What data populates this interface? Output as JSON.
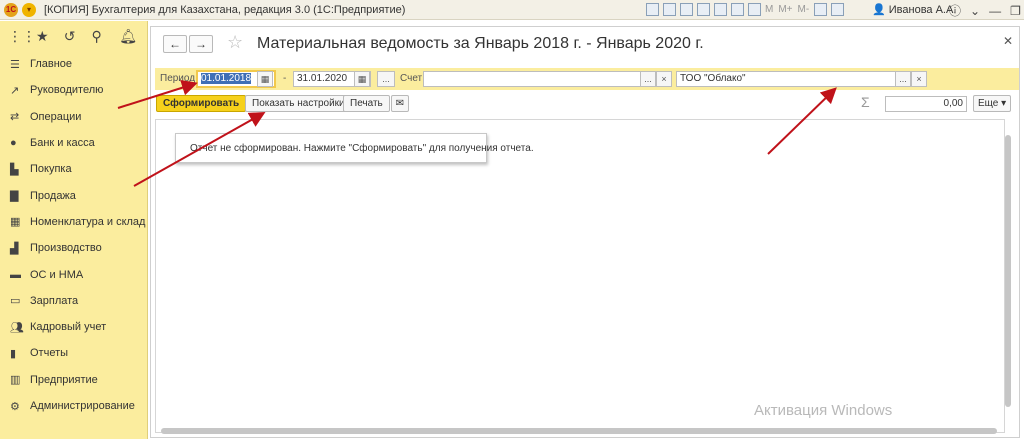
{
  "window": {
    "title": "[КОПИЯ] Бухгалтерия для Казахстана, редакция 3.0  (1С:Предприятие)",
    "tool_letters": [
      "M",
      "M+",
      "M-"
    ],
    "user": "Иванова А.А."
  },
  "sidebar": {
    "items": [
      {
        "label": "Главное",
        "icon": "menu-icon"
      },
      {
        "label": "Руководителю",
        "icon": "chart-line-icon"
      },
      {
        "label": "Операции",
        "icon": "operations-icon"
      },
      {
        "label": "Банк и касса",
        "icon": "bank-icon"
      },
      {
        "label": "Покупка",
        "icon": "cart-icon"
      },
      {
        "label": "Продажа",
        "icon": "bag-icon"
      },
      {
        "label": "Номенклатура и склад",
        "icon": "boxes-icon"
      },
      {
        "label": "Производство",
        "icon": "factory-icon"
      },
      {
        "label": "ОС и НМА",
        "icon": "truck-icon"
      },
      {
        "label": "Зарплата",
        "icon": "wallet-icon"
      },
      {
        "label": "Кадровый учет",
        "icon": "people-icon"
      },
      {
        "label": "Отчеты",
        "icon": "bar-chart-icon"
      },
      {
        "label": "Предприятие",
        "icon": "building-icon"
      },
      {
        "label": "Администрирование",
        "icon": "gear-icon"
      }
    ]
  },
  "form": {
    "title": "Материальная ведомость  за Январь 2018 г. - Январь 2020 г.",
    "period_label": "Период:",
    "date_from": "01.01.2018",
    "date_dash": "-",
    "date_to": "31.01.2020",
    "more_label": "...",
    "account_label": "Счет:",
    "account_value": "",
    "organization_value": "ТОО \"Облако\"",
    "clear_label": "×"
  },
  "toolbar": {
    "generate_label": "Сформировать",
    "settings_label": "Показать настройки",
    "print_label": "Печать",
    "sum_value": "0,00",
    "more_label": "Еще ▾"
  },
  "report": {
    "message": "Отчет не сформирован. Нажмите \"Сформировать\" для получения отчета."
  },
  "watermark": {
    "line1": "Активация Windows"
  },
  "colors": {
    "sidebar_bg": "#fbed9e",
    "primary_button": "#f6d11b",
    "annotation_arrow": "#c0121a"
  }
}
